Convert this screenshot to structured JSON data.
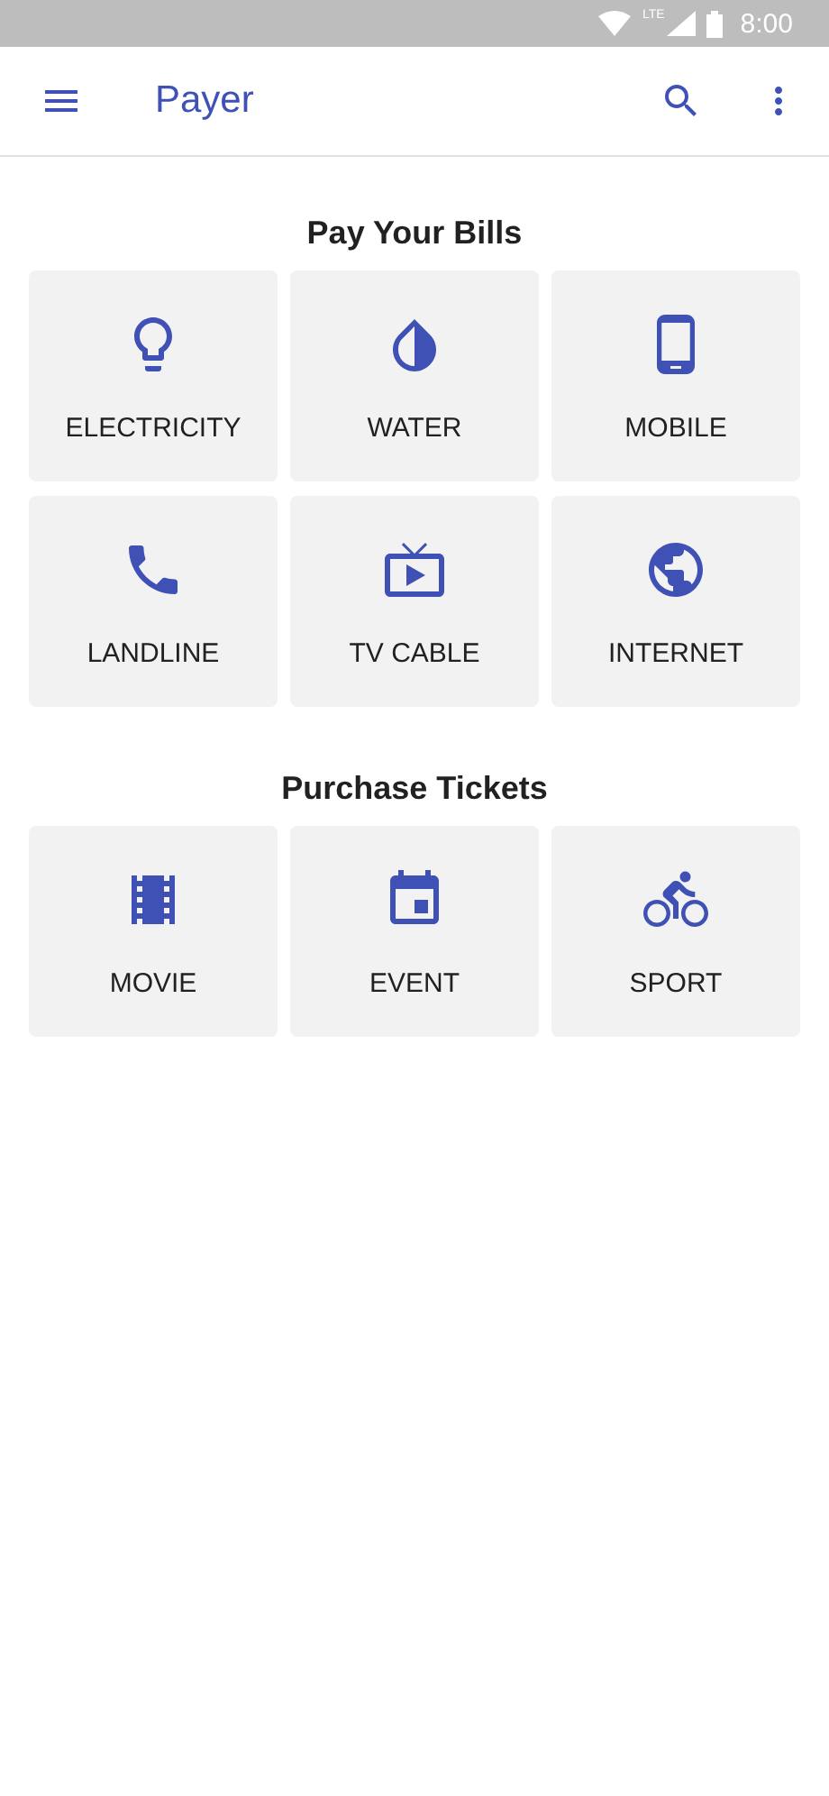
{
  "status_bar": {
    "time": "8:00",
    "network": "LTE"
  },
  "app_bar": {
    "title": "Payer"
  },
  "sections": [
    {
      "title": "Pay Your Bills",
      "tiles": [
        {
          "kind": "bulb",
          "label": "ELECTRICITY"
        },
        {
          "kind": "drop",
          "label": "WATER"
        },
        {
          "kind": "phone",
          "label": "MOBILE"
        },
        {
          "kind": "handset",
          "label": "LANDLINE"
        },
        {
          "kind": "tv",
          "label": "TV CABLE"
        },
        {
          "kind": "globe",
          "label": "INTERNET"
        }
      ]
    },
    {
      "title": "Purchase Tickets",
      "tiles": [
        {
          "kind": "film",
          "label": "MOVIE"
        },
        {
          "kind": "calendar",
          "label": "EVENT"
        },
        {
          "kind": "bike",
          "label": "SPORT"
        }
      ]
    }
  ]
}
